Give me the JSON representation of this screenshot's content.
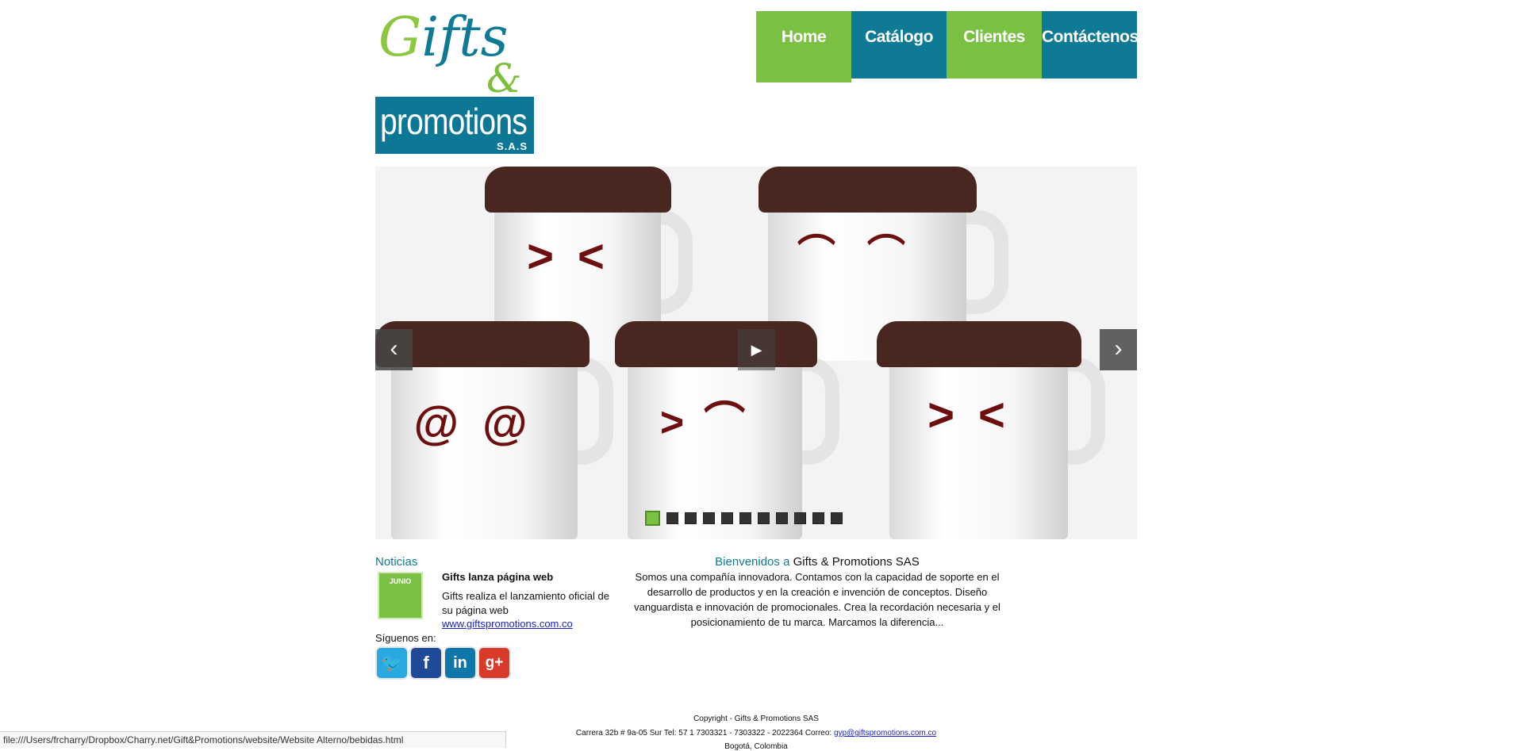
{
  "logo": {
    "script_text": "Gifts",
    "amp_text": "&",
    "word": "promotions",
    "suffix": "S.A.S"
  },
  "nav": [
    {
      "label": "Home"
    },
    {
      "label": "Catálogo"
    },
    {
      "label": "Clientes"
    },
    {
      "label": "Contáctenos"
    }
  ],
  "slider": {
    "prev_label": "‹",
    "next_label": "›",
    "play_label": "▶",
    "dot_count": 11,
    "active_dot": 0
  },
  "news": {
    "title": "Noticias",
    "badge": "JUNIO",
    "headline": "Gifts lanza página web",
    "body": "Gifts realiza el lanzamiento oficial de su página web",
    "link": "www.giftspromotions.com.co"
  },
  "social": {
    "label": "Síguenos en:",
    "icons": [
      "twitter-icon",
      "facebook-icon",
      "linkedin-icon",
      "googleplus-icon"
    ]
  },
  "welcome": {
    "lead": "Bienvenidos a",
    "company": "Gifts & Promotions SAS",
    "body": "Somos una compañía innovadora. Contamos con la capacidad de soporte en el desarrollo de productos y en la creación e invención de conceptos. Diseño vanguardista e innovación de promocionales. Crea la recordación necesaria y el posicionamiento de tu marca. Marcamos la diferencia..."
  },
  "footer": {
    "copyright": "Copyright - Gifts & Promotions SAS",
    "address": "Carrera 32b # 9a-05 Sur Tel: 57 1 7303321 - 7303322 - 2022364 Correo:",
    "email": "gyp@giftspromotions.com.co",
    "city": "Bogotá, Colombia"
  },
  "status_url": "file:///Users/frcharry/Dropbox/Charry.net/Gift&Promotions/website/Website Alterno/bebidas.html",
  "colors": {
    "green": "#7ac143",
    "teal": "#0f7a95",
    "lid": "#4a2620",
    "face": "#6d0f0f"
  }
}
